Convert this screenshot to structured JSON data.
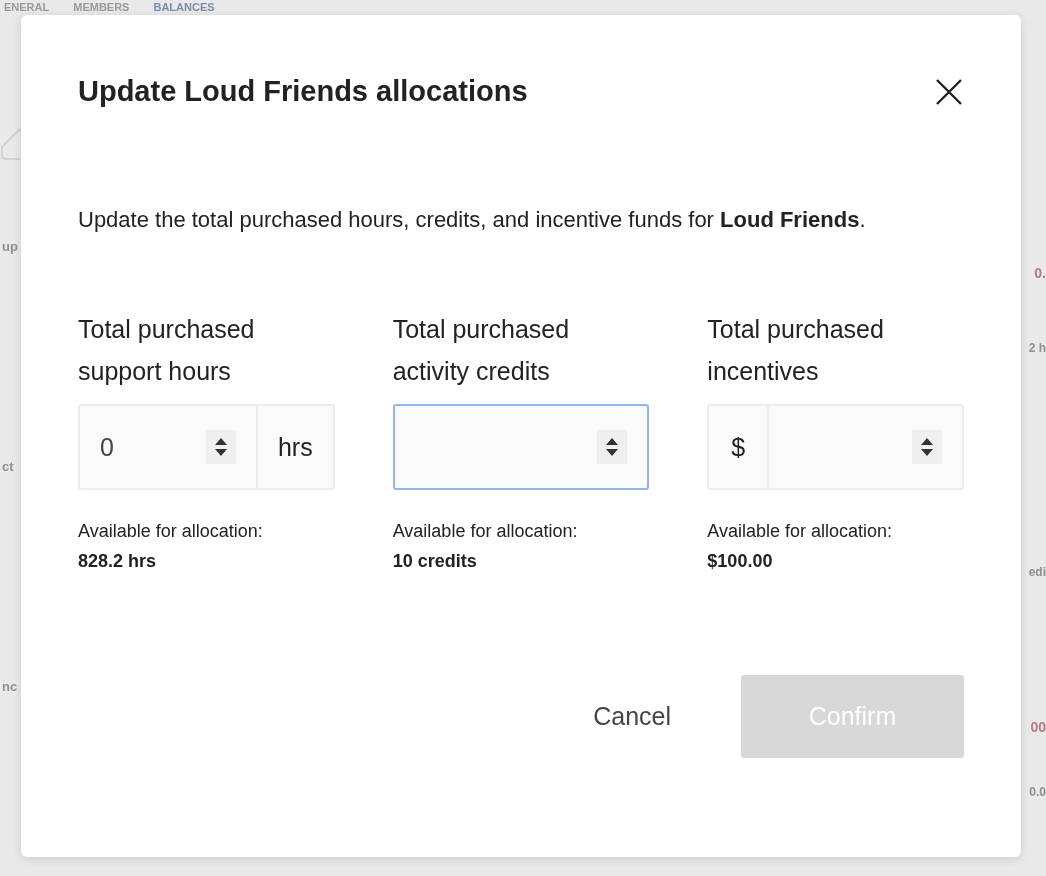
{
  "background": {
    "tabs": [
      {
        "label": "ENERAL",
        "selected": false
      },
      {
        "label": "MEMBERS",
        "selected": false
      },
      {
        "label": "BALANCES",
        "selected": true
      }
    ],
    "left_fragments": [
      "up",
      "ct",
      "nc"
    ],
    "right_fragments": [
      {
        "text": "0.",
        "kind": "amount"
      },
      {
        "text": "2 h",
        "kind": "note"
      },
      {
        "text": "edi",
        "kind": "note"
      },
      {
        "text": "00",
        "kind": "amount"
      },
      {
        "text": "0.0",
        "kind": "note"
      }
    ]
  },
  "dialog": {
    "title": "Update Loud Friends allocations",
    "description": "Update the total purchased hours, credits, and incentive funds for **Loud Friends**.",
    "fields": [
      {
        "label": "Total purchased support hours",
        "kind": "suffix",
        "unit": "hrs",
        "value": "0",
        "focused": false,
        "available_label": "Available for allocation:",
        "available_value": "828.2 hrs"
      },
      {
        "label": "Total purchased activity credits",
        "kind": "plain",
        "focused": true,
        "available_label": "Available for allocation:",
        "available_value": "10 credits"
      },
      {
        "label": "Total purchased incentives",
        "kind": "prefix",
        "unit": "$",
        "focused": false,
        "available_label": "Available for allocation:",
        "available_value": "$100.00"
      }
    ],
    "buttons": [
      {
        "label": "Cancel",
        "kind": "text",
        "disabled": false
      },
      {
        "label": "Confirm",
        "kind": "primary",
        "disabled": true
      }
    ]
  }
}
